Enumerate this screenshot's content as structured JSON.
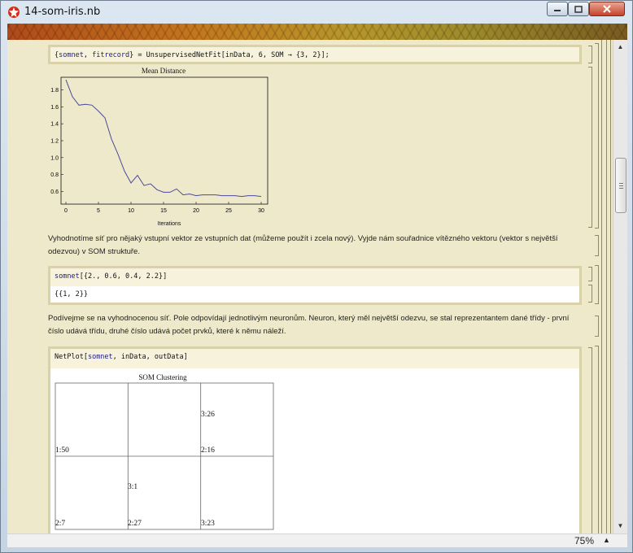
{
  "window": {
    "title": "14-som-iris.nb",
    "buttons": [
      "minimize",
      "maximize",
      "close"
    ]
  },
  "cells": {
    "input1": {
      "open_brace": "{",
      "var1": "somnet",
      "sep": ", ",
      "var2": "fitrecord",
      "rest": "} = UnsupervisedNetFit[inData, 6, SOM → {3, 2}];"
    },
    "plot1": {
      "title": "Mean Distance",
      "xlabel": "Iterations"
    },
    "text1": "Vyhodnotíme síť pro nějaký vstupní vektor ze vstupních dat (můžeme použít i zcela nový). Vyjde nám souřadnice vítězného vektoru (vektor s největší odezvou) v SOM struktuře.",
    "input2": {
      "var": "somnet",
      "rest": "[{2., 0.6, 0.4, 2.2}]"
    },
    "output2": "{{1, 2}}",
    "text2": "Podívejme se na vyhodnocenou síť. Pole odpovídají jednotlivým neuronům. Neuron, který měl největší odezvu, se stal reprezentantem dané třídy - první číslo udává třídu, druhé číslo udává počet prvků, které k němu náleží.",
    "input3": {
      "fn": "NetPlot[",
      "var": "somnet",
      "rest": ", inData, outData]"
    },
    "som_plot": {
      "title": "SOM Clustering",
      "grid_labels": [
        [
          "",
          "",
          "3:26"
        ],
        [
          "1:50",
          "",
          "2:16"
        ],
        [
          "",
          "3:1",
          ""
        ],
        [
          "2:7",
          "2:27",
          "3:23"
        ]
      ]
    }
  },
  "status": {
    "zoom": "75%"
  },
  "colors": {
    "notebook_bg": "#efe9cc",
    "input_bg": "#f7f2dc",
    "input_border": "#d9d2a8",
    "plot_line": "#4a4a9a",
    "bracket": "#8e8a62"
  },
  "chart_data": {
    "type": "line",
    "title": "Mean Distance",
    "xlabel": "Iterations",
    "ylabel": "",
    "xlim": [
      0,
      31
    ],
    "ylim": [
      0.45,
      1.95
    ],
    "xticks": [
      0,
      5,
      10,
      15,
      20,
      25,
      30
    ],
    "yticks": [
      0.6,
      0.8,
      1.0,
      1.2,
      1.4,
      1.6,
      1.8
    ],
    "series": [
      {
        "x": [
          0,
          1,
          2,
          3,
          4,
          5,
          6,
          7,
          8,
          9,
          10,
          11,
          12,
          13,
          14,
          15,
          16,
          17,
          18,
          19,
          20,
          21,
          22,
          23,
          24,
          25,
          26,
          27,
          28,
          29,
          30
        ],
        "values": [
          1.92,
          1.72,
          1.62,
          1.63,
          1.62,
          1.55,
          1.47,
          1.22,
          1.04,
          0.84,
          0.7,
          0.79,
          0.67,
          0.69,
          0.62,
          0.59,
          0.59,
          0.63,
          0.56,
          0.57,
          0.55,
          0.56,
          0.56,
          0.56,
          0.55,
          0.55,
          0.55,
          0.54,
          0.55,
          0.55,
          0.54
        ]
      }
    ]
  }
}
